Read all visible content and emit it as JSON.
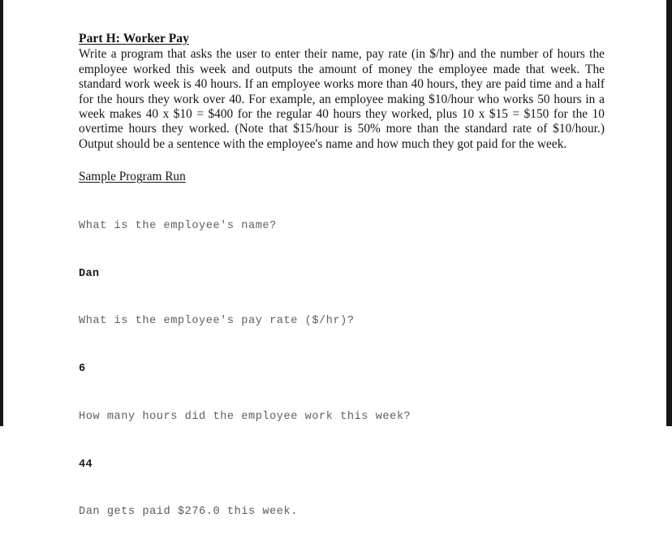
{
  "document": {
    "heading": "Part H: Worker Pay",
    "body_paragraph": "Write a program that asks the user to enter their name, pay rate (in $/hr) and the number of hours the employee worked this week and outputs the amount of money the employee made that week. The standard work week is 40 hours. If an employee works more than 40 hours, they are paid time and a half for the hours they work over 40. For example, an employee making $10/hour who works 50 hours in a week makes 40 x $10 = $400 for the regular 40 hours they worked, plus 10 x $15 = $150 for the 10 overtime hours they worked. (Note that $15/hour is 50% more than the standard rate of $10/hour.) Output should be a sentence with the employee's name and how much they got paid for the week.",
    "sample_run": {
      "title": "Sample Program Run",
      "lines": [
        {
          "kind": "prompt",
          "text": "What is the employee's name?"
        },
        {
          "kind": "entry",
          "text": "Dan"
        },
        {
          "kind": "prompt",
          "text": "What is the employee's pay rate ($/hr)?"
        },
        {
          "kind": "entry",
          "text": "6"
        },
        {
          "kind": "prompt",
          "text": "How many hours did the employee work this week?"
        },
        {
          "kind": "entry",
          "text": "44"
        },
        {
          "kind": "result",
          "text": "Dan gets paid $276.0 this week."
        }
      ]
    }
  }
}
